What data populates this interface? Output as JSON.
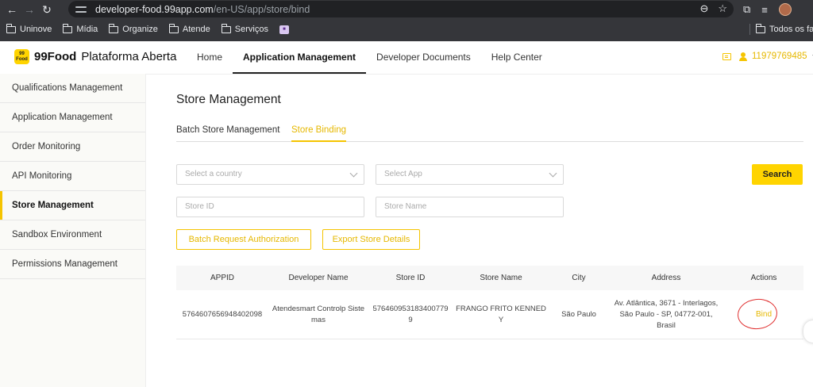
{
  "browser": {
    "url_host": "developer-food.99app.com",
    "url_path": "/en-US/app/store/bind",
    "bookmarks": [
      "Uninove",
      "Mídia",
      "Organize",
      "Atende",
      "Serviços"
    ],
    "bookmarks_right": "Todos os favo"
  },
  "header": {
    "logo_badge_top": "99",
    "logo_badge_bottom": "Food",
    "brand": "99Food",
    "brand_sub": "Plataforma Aberta",
    "nav": [
      "Home",
      "Application Management",
      "Developer Documents",
      "Help Center"
    ],
    "user_phone": "11979769485"
  },
  "sidebar": {
    "items": [
      "Qualifications Management",
      "Application Management",
      "Order Monitoring",
      "API Monitoring",
      "Store Management",
      "Sandbox Environment",
      "Permissions Management"
    ]
  },
  "main": {
    "title": "Store Management",
    "tabs": [
      "Batch Store Management",
      "Store Binding"
    ],
    "filters": {
      "country_placeholder": "Select a country",
      "app_placeholder": "Select App",
      "store_id_placeholder": "Store ID",
      "store_name_placeholder": "Store Name"
    },
    "search_label": "Search",
    "batch_auth_label": "Batch Request Authorization",
    "export_label": "Export Store Details"
  },
  "table": {
    "columns": [
      "APPID",
      "Developer Name",
      "Store ID",
      "Store Name",
      "City",
      "Address",
      "Actions"
    ],
    "rows": [
      {
        "appid": "5764607656948402098",
        "developer": "Atendesmart Controlp Sistemas",
        "store_id": "5764609531834007799",
        "store_name": "FRANGO FRITO KENNEDY",
        "city": "São Paulo",
        "address": "Av. Atlântica, 3671 - Interlagos, São Paulo - SP, 04772-001, Brasil",
        "action": "Bind"
      }
    ]
  },
  "colors": {
    "accent": "#ffd400",
    "accent_text": "#e6b800",
    "annotation": "#e03030"
  }
}
